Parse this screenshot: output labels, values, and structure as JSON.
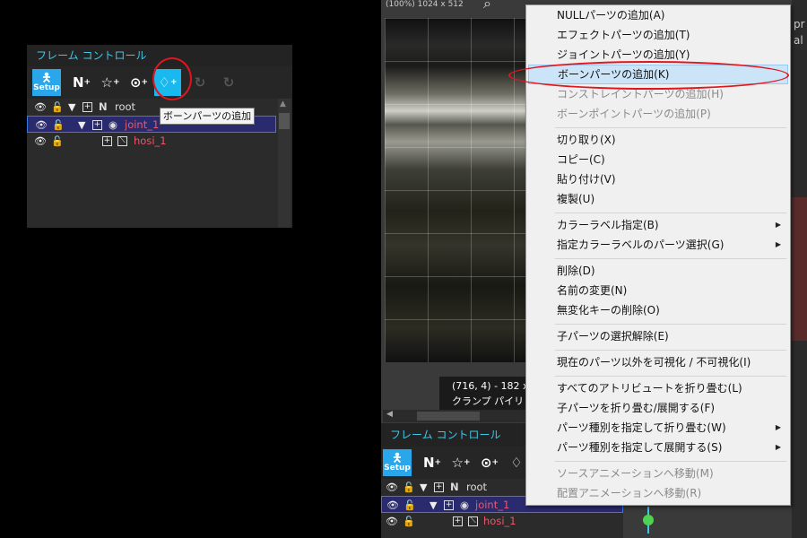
{
  "colors": {
    "accent": "#3fc8e6",
    "highlight": "#19b9f0",
    "red_label": "#e85a6a",
    "annotation": "#e0161e"
  },
  "left_panel": {
    "title": "フレーム コントロール",
    "toolbar": {
      "setup_label": "Setup",
      "null_glyph": "N"
    },
    "tooltip": "ボーンパーツの追加",
    "tree": [
      {
        "label": "root",
        "type_glyph": "N"
      },
      {
        "label": "joint_1"
      },
      {
        "label": "hosi_1"
      }
    ]
  },
  "preview": {
    "top_info": "(100%) 1024 x 512",
    "coord_line1": "(716, 4) - 182 x",
    "coord_line2": "クランプ パイリ"
  },
  "bottom_panel": {
    "title": "フレーム コントロール",
    "toolbar": {
      "setup_label": "Setup",
      "null_glyph": "N"
    },
    "tree": [
      {
        "label": "root",
        "type_glyph": "N"
      },
      {
        "label": "joint_1"
      },
      {
        "label": "hosi_1"
      }
    ]
  },
  "right_strip": {
    "text1": "pr",
    "text2": "al"
  },
  "context_menu": {
    "items": [
      {
        "label": "NULLパーツの追加(A)"
      },
      {
        "label": "エフェクトパーツの追加(T)"
      },
      {
        "label": "ジョイントパーツの追加(Y)"
      },
      {
        "label": "ボーンパーツの追加(K)"
      },
      {
        "label": "コンストレイントパーツの追加(H)"
      },
      {
        "label": "ボーンポイントパーツの追加(P)"
      },
      {
        "label": "切り取り(X)"
      },
      {
        "label": "コピー(C)"
      },
      {
        "label": "貼り付け(V)"
      },
      {
        "label": "複製(U)"
      },
      {
        "label": "カラーラベル指定(B)"
      },
      {
        "label": "指定カラーラベルのパーツ選択(G)"
      },
      {
        "label": "削除(D)"
      },
      {
        "label": "名前の変更(N)"
      },
      {
        "label": "無変化キーの削除(O)"
      },
      {
        "label": "子パーツの選択解除(E)"
      },
      {
        "label": "現在のパーツ以外を可視化 / 不可視化(I)"
      },
      {
        "label": "すべてのアトリビュートを折り畳む(L)"
      },
      {
        "label": "子パーツを折り畳む/展開する(F)"
      },
      {
        "label": "パーツ種別を指定して折り畳む(W)"
      },
      {
        "label": "パーツ種別を指定して展開する(S)"
      },
      {
        "label": "ソースアニメーションへ移動(M)"
      },
      {
        "label": "配置アニメーションへ移動(R)"
      }
    ]
  }
}
